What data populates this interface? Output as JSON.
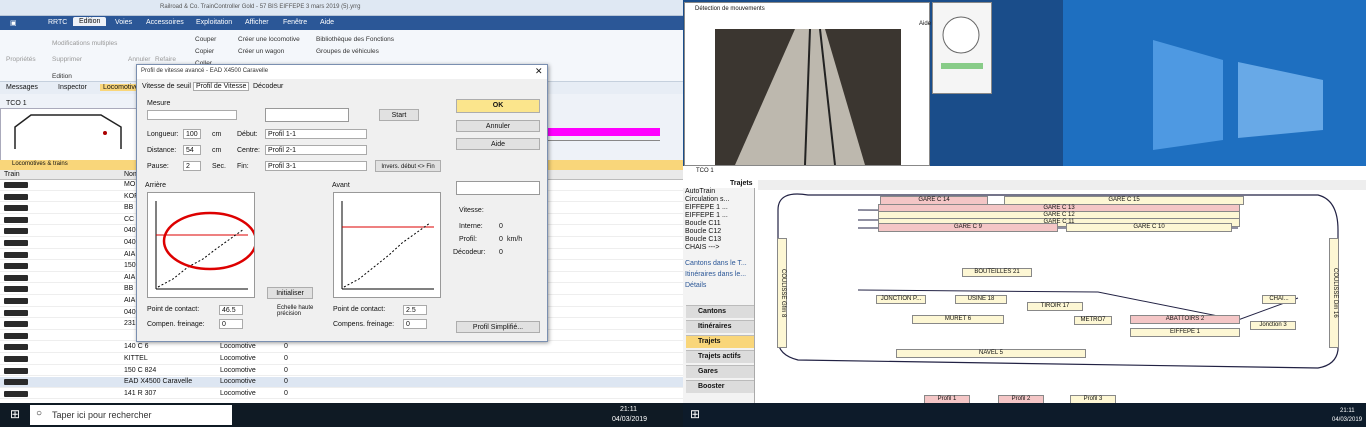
{
  "app": {
    "title": "Railroad & Co. TrainController Gold - 57 BIS EIFFEPE 3 mars 2019 (5).yrrg",
    "menu": [
      "RRTC",
      "Edition",
      "Voies",
      "Accessoires",
      "Exploitation",
      "Afficher",
      "Fenêtre",
      "Aide"
    ],
    "ribbon": {
      "props": "Propriétés",
      "modif": "Modifications multiples",
      "suppr": "Supprimer",
      "annuler": "Annuler",
      "refaire": "Refaire",
      "couper": "Couper",
      "copier": "Copier",
      "coller": "Coller",
      "creerloco": "Créer une locomotive",
      "creerwagon": "Créer un wagon",
      "biblio": "Bibliothèque des Fonctions",
      "groupes": "Groupes de véhicules",
      "edition": "Edition"
    },
    "tabs": [
      "Messages",
      "Inspector",
      "Locomotive"
    ],
    "tco": "TCO 1",
    "listtitle": "Locomotives & trains",
    "cols": [
      "Train",
      "Nom"
    ],
    "rows": [
      {
        "n": "MO"
      },
      {
        "n": "KOF"
      },
      {
        "n": "BB"
      },
      {
        "n": "CC"
      },
      {
        "n": "040"
      },
      {
        "n": "040"
      },
      {
        "n": "AIA"
      },
      {
        "n": "150"
      },
      {
        "n": "AIA"
      },
      {
        "n": "BB"
      },
      {
        "n": "AIA"
      },
      {
        "n": "040"
      },
      {
        "n": "231"
      },
      {
        "n": "",
        "t": "Locomotive",
        "v": "0"
      },
      {
        "n": "140 C 6",
        "t": "Locomotive",
        "v": "0"
      },
      {
        "n": "KITTEL",
        "t": "Locomotive",
        "v": "0"
      },
      {
        "n": "150 C 824",
        "t": "Locomotive",
        "v": "0"
      },
      {
        "n": "EAD X4500 Caravelle",
        "t": "Locomotive",
        "v": "0"
      },
      {
        "n": "141 R 307",
        "t": "Locomotive",
        "v": "0"
      }
    ]
  },
  "dialog": {
    "title": "Profil de vitesse avancé - EAD X4500 Caravelle",
    "tabs": [
      "Vitesse de seuil",
      "Profil de Vitesse",
      "Décodeur"
    ],
    "mesure": "Mesure",
    "longueur": "Longueur:",
    "longv": "100",
    "cm": "cm",
    "distance": "Distance:",
    "distv": "54",
    "pause": "Pause:",
    "pausev": "2",
    "sec": "Sec.",
    "debut": "Début:",
    "centre": "Centre:",
    "fin": "Fin:",
    "p1": "Profil 1-1",
    "p2": "Profil 2-1",
    "p3": "Profil 3-1",
    "start": "Start",
    "invers": "Invers. début <> Fin",
    "ok": "OK",
    "annuler": "Annuler",
    "aide": "Aide",
    "arriere": "Arrière",
    "avant": "Avant",
    "initialiser": "Initialiser",
    "echelle": "Echelle haute précision",
    "pc": "Point de contact:",
    "pcv1": "46.5",
    "pcv2": "2.5",
    "cf": "Compen. freinage:",
    "cf2": "Compens. freinage:",
    "cfv": "0",
    "vitesse": "Vitesse:",
    "interne": "Interne:",
    "profil": "Profil:",
    "decodeur": "Décodeur:",
    "kmh": "km/h",
    "zero": "0",
    "simpl": "Profil Simplifié...",
    "gold": "GOLD"
  },
  "video": {
    "title": "Détection de mouvements",
    "aide": "Aide"
  },
  "traffic": {
    "title": "TCO 1",
    "trajets": "Trajets",
    "list": [
      "AutoTrain",
      "Circulation s...",
      "EIFFEPE 1 ...",
      "EIFFEPE 1 ...",
      "Boucle C11",
      "Boucle C12",
      "Boucle C13",
      "CHAIS --->"
    ],
    "cantons": "Cantons dans le T...",
    "itin": "Itinéraires dans le...",
    "details": "Détails",
    "side": [
      "Cantons",
      "Itinéraires",
      "Trajets",
      "Trajets actifs",
      "Gares",
      "Booster"
    ],
    "blocks": {
      "g14": "GARE C 14",
      "g15": "GARE C 15",
      "g13": "GARE C 13",
      "g12": "GARE C 12",
      "g11": "GARE C 11",
      "g9": "GARE C 9",
      "g10": "GARE C 10",
      "bout": "BOUTEILLES 21",
      "usine": "USINE 18",
      "tiroir": "TIROIR 17",
      "jonc": "JONCTION P...",
      "muret": "MURET 6",
      "metro": "METRO7",
      "abat": "ABATTOIRS 2",
      "eiff": "EIFFEPE 1",
      "navel": "NAVEL 5",
      "chai": "CHAI...",
      "jonc3": "Jonction 3",
      "coul8": "COULISSE Gfm 8",
      "coul16": "COULISSE Dm 16",
      "p1": "Profil 1",
      "p2": "Profil 2",
      "p3": "Profil 3",
      "voie": "VOIE"
    }
  },
  "taskbar": {
    "search": "Taper ici pour rechercher",
    "time": "21:11",
    "date": "04/03/2019"
  }
}
